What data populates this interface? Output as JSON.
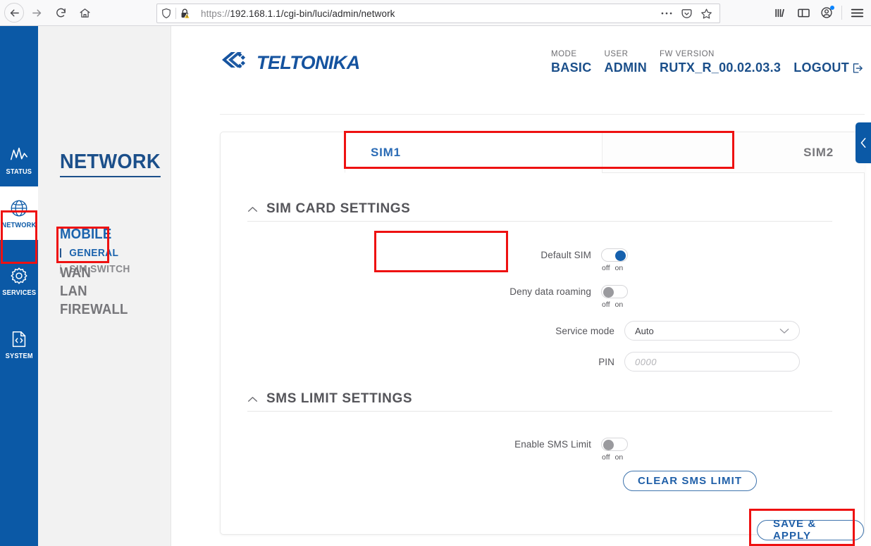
{
  "browser": {
    "back_icon": "back-arrow-icon",
    "forward_icon": "forward-arrow-icon",
    "reload_icon": "reload-icon",
    "home_icon": "home-icon",
    "shield_icon": "tracking-protection-shield-icon",
    "lock_icon": "insecure-lock-warning-icon",
    "url_scheme": "https://",
    "url_rest": "192.168.1.1/cgi-bin/luci/admin/network",
    "url_full": "https://192.168.1.1/cgi-bin/luci/admin/network",
    "page_actions_icon": "page-actions-ellipsis-icon",
    "pocket_icon": "pocket-icon",
    "bookmark_icon": "bookmark-star-icon",
    "library_icon": "library-icon",
    "sidebar_icon": "sidebar-icon",
    "account_icon": "account-icon",
    "menu_icon": "hamburger-menu-icon"
  },
  "rail": {
    "items": [
      {
        "label": "STATUS",
        "icon": "status-pulse-icon",
        "active": false
      },
      {
        "label": "NETWORK",
        "icon": "network-globe-icon",
        "active": true
      },
      {
        "label": "SERVICES",
        "icon": "services-gear-icon",
        "active": false
      },
      {
        "label": "SYSTEM",
        "icon": "system-code-file-icon",
        "active": false
      }
    ]
  },
  "submenu": {
    "title": "NETWORK",
    "mobile": {
      "label": "MOBILE",
      "children": [
        {
          "label": "GENERAL",
          "active": true
        },
        {
          "label": "SIM SWITCH",
          "active": false
        }
      ]
    },
    "others": [
      {
        "label": "WAN"
      },
      {
        "label": "LAN"
      },
      {
        "label": "FIREWALL"
      }
    ]
  },
  "topbar": {
    "logo_text": "TELTONIKA",
    "meta": [
      {
        "key": "MODE",
        "value": "BASIC"
      },
      {
        "key": "USER",
        "value": "ADMIN"
      },
      {
        "key": "FW VERSION",
        "value": "RUTX_R_00.02.03.3"
      }
    ],
    "logout_label": "LOGOUT",
    "logout_icon": "logout-exit-icon"
  },
  "card": {
    "tabs": [
      {
        "label": "SIM1",
        "active": true
      },
      {
        "label": "SIM2",
        "active": false
      }
    ],
    "sections": [
      {
        "title": "SIM CARD SETTINGS",
        "collapse_icon": "chevron-up-icon"
      },
      {
        "title": "SMS LIMIT SETTINGS",
        "collapse_icon": "chevron-up-icon"
      }
    ],
    "fields": {
      "default_sim": {
        "label": "Default SIM",
        "state": "on",
        "off_label": "off",
        "on_label": "on"
      },
      "deny_roaming": {
        "label": "Deny data roaming",
        "state": "off",
        "off_label": "off",
        "on_label": "on"
      },
      "service_mode": {
        "label": "Service mode",
        "value": "Auto",
        "dropdown_icon": "chevron-down-icon"
      },
      "pin": {
        "label": "PIN",
        "value": "",
        "placeholder": "0000"
      },
      "enable_sms_limit": {
        "label": "Enable SMS Limit",
        "state": "off",
        "off_label": "off",
        "on_label": "on"
      }
    },
    "buttons": {
      "clear_sms_limit": "CLEAR SMS LIMIT",
      "save_apply": "SAVE & APPLY"
    }
  },
  "drawer": {
    "icon": "chevron-left-icon"
  },
  "colors": {
    "brand_blue": "#0b59a6",
    "link_blue": "#1b4f8a",
    "annotation_red": "#ee1111",
    "toggle_on": "#1560ad",
    "sidebar_bg": "#f2f2f2"
  }
}
